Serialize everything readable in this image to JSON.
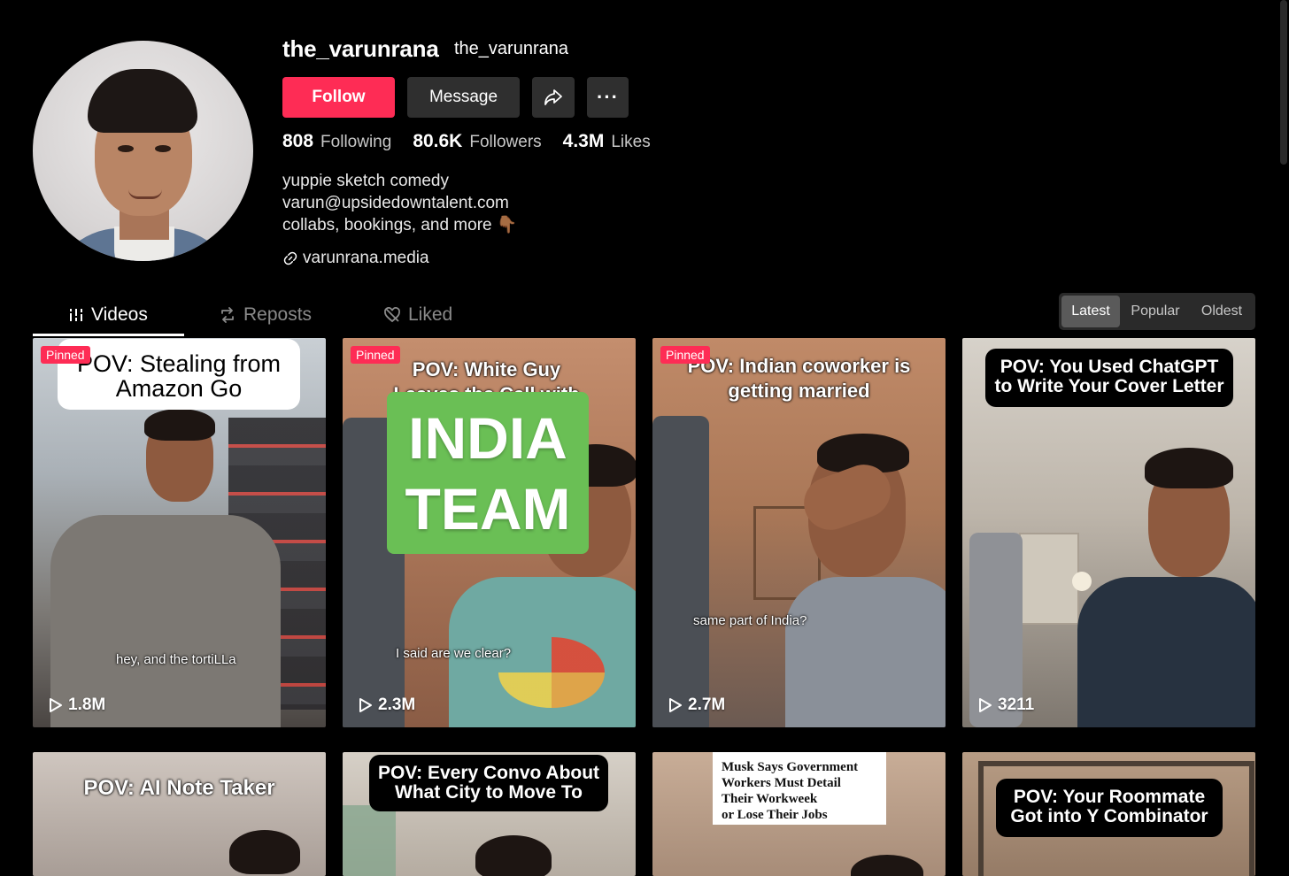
{
  "profile": {
    "username": "the_varunrana",
    "nickname": "the_varunrana",
    "stats": [
      {
        "value": "808",
        "label": "Following"
      },
      {
        "value": "80.6K",
        "label": "Followers"
      },
      {
        "value": "4.3M",
        "label": "Likes"
      }
    ],
    "bio": [
      "yuppie sketch comedy",
      "varun@upsidedowntalent.com",
      "collabs, bookings, and more 👇🏾"
    ],
    "link": "varunrana.media"
  },
  "actions": {
    "follow_label": "Follow",
    "message_label": "Message",
    "share_icon": "share-icon",
    "more_label": "···"
  },
  "tabs": [
    "Videos",
    "Reposts",
    "Liked"
  ],
  "sort": [
    "Latest",
    "Popular",
    "Oldest"
  ],
  "colors": {
    "accent": "#fe2c55",
    "button": "#2f2f2f",
    "background": "#000000",
    "india_box": "#6abf55"
  },
  "videos": [
    {
      "pinned": "Pinned",
      "caption": [
        "POV: Stealing from",
        "Amazon Go"
      ],
      "subtitle": "hey, and the tortiLLa",
      "views": "1.8M"
    },
    {
      "pinned": "Pinned",
      "caption": [
        "POV: White Guy",
        "Leaves the Call with"
      ],
      "overlay": [
        "INDIA",
        "TEAM"
      ],
      "subtitle": "I said are we clear?",
      "views": "2.3M"
    },
    {
      "pinned": "Pinned",
      "caption": [
        "POV: Indian coworker is",
        "getting married"
      ],
      "subtitle": "same part of India?",
      "views": "2.7M"
    },
    {
      "caption": [
        "POV: You Used ChatGPT",
        "to Write Your Cover Letter"
      ],
      "views": "3211"
    },
    {
      "caption": [
        "POV: AI Note Taker"
      ]
    },
    {
      "caption": [
        "POV: Every Convo About",
        "What City to Move To"
      ]
    },
    {
      "news": [
        "Musk Says Government",
        "Workers Must Detail",
        "Their Workweek",
        "or Lose Their Jobs"
      ]
    },
    {
      "caption": [
        "POV: Your Roommate",
        "Got into Y Combinator"
      ]
    }
  ]
}
